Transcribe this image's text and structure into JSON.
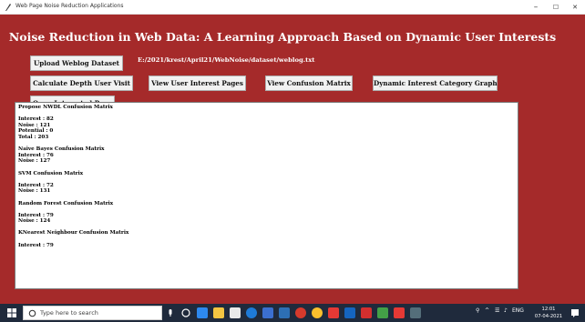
{
  "window": {
    "title": "Web Page Noise Reduction Applications",
    "minimize": "–",
    "maximize": "☐",
    "close": "✕"
  },
  "app": {
    "heading": "Noise Reduction in Web Data: A Learning Approach Based on Dynamic User Interests",
    "dataset_path": "E:/2021/krest/April21/WebNoise/dataset/weblog.txt",
    "buttons": {
      "upload": "Upload Weblog Dataset",
      "depth": "Calculate Depth User Visit",
      "interest_pages": "View User Interest Pages",
      "confusion": "View Confusion Matrix",
      "category_graph": "Dynamic Interest Category Graph",
      "open_page": "Open Interested Page"
    }
  },
  "output_lines": [
    "Propose NWDL Confusion Matrix",
    "",
    "Interest : 82",
    "Noise : 121",
    "Potential : 0",
    "Total : 203",
    "",
    "Naive Bayes Confusion Matrix",
    "Interest : 76",
    "Noise : 127",
    "",
    "SVM Confusion Matrix",
    "",
    "Interest : 72",
    "Noise : 131",
    "",
    "Random Forest Confusion Matrix",
    "",
    "Interest : 79",
    "Noise : 124",
    "",
    "KNearest Neighbour Confusion Matrix",
    "",
    "Interest : 79"
  ],
  "taskbar": {
    "search_placeholder": "Type here to search",
    "tray_text": "ENG",
    "time": "12:01",
    "date": "07-04-2021"
  },
  "colors": {
    "accent": "#a52a2a",
    "taskbar": "#1f2a3c"
  }
}
